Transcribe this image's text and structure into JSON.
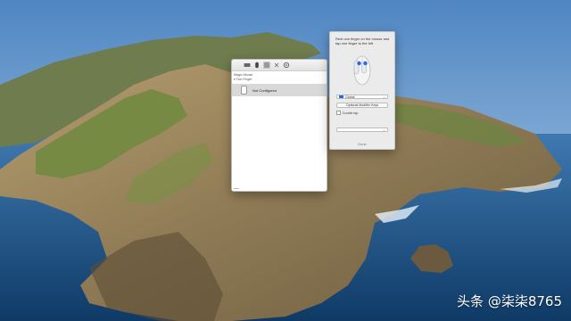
{
  "pref_panel": {
    "tree_title": "Magic Mouse",
    "tree_group": "▾ Two Finger",
    "row_label": "Not Configured",
    "toolbar_icons": [
      "keyboard-icon",
      "mouse-icon",
      "blank-icon",
      "close-icon",
      "gear-icon"
    ]
  },
  "sheet": {
    "instruction": "Rest one finger on the mouse and tap one finger to the left",
    "scope_select": "Global",
    "optional_modifier_label": "Optional Modifier Keys",
    "double_tap_label": "Double tap",
    "action_select": "",
    "done_label": "Done"
  },
  "watermark": "头条 @柒柒8765"
}
